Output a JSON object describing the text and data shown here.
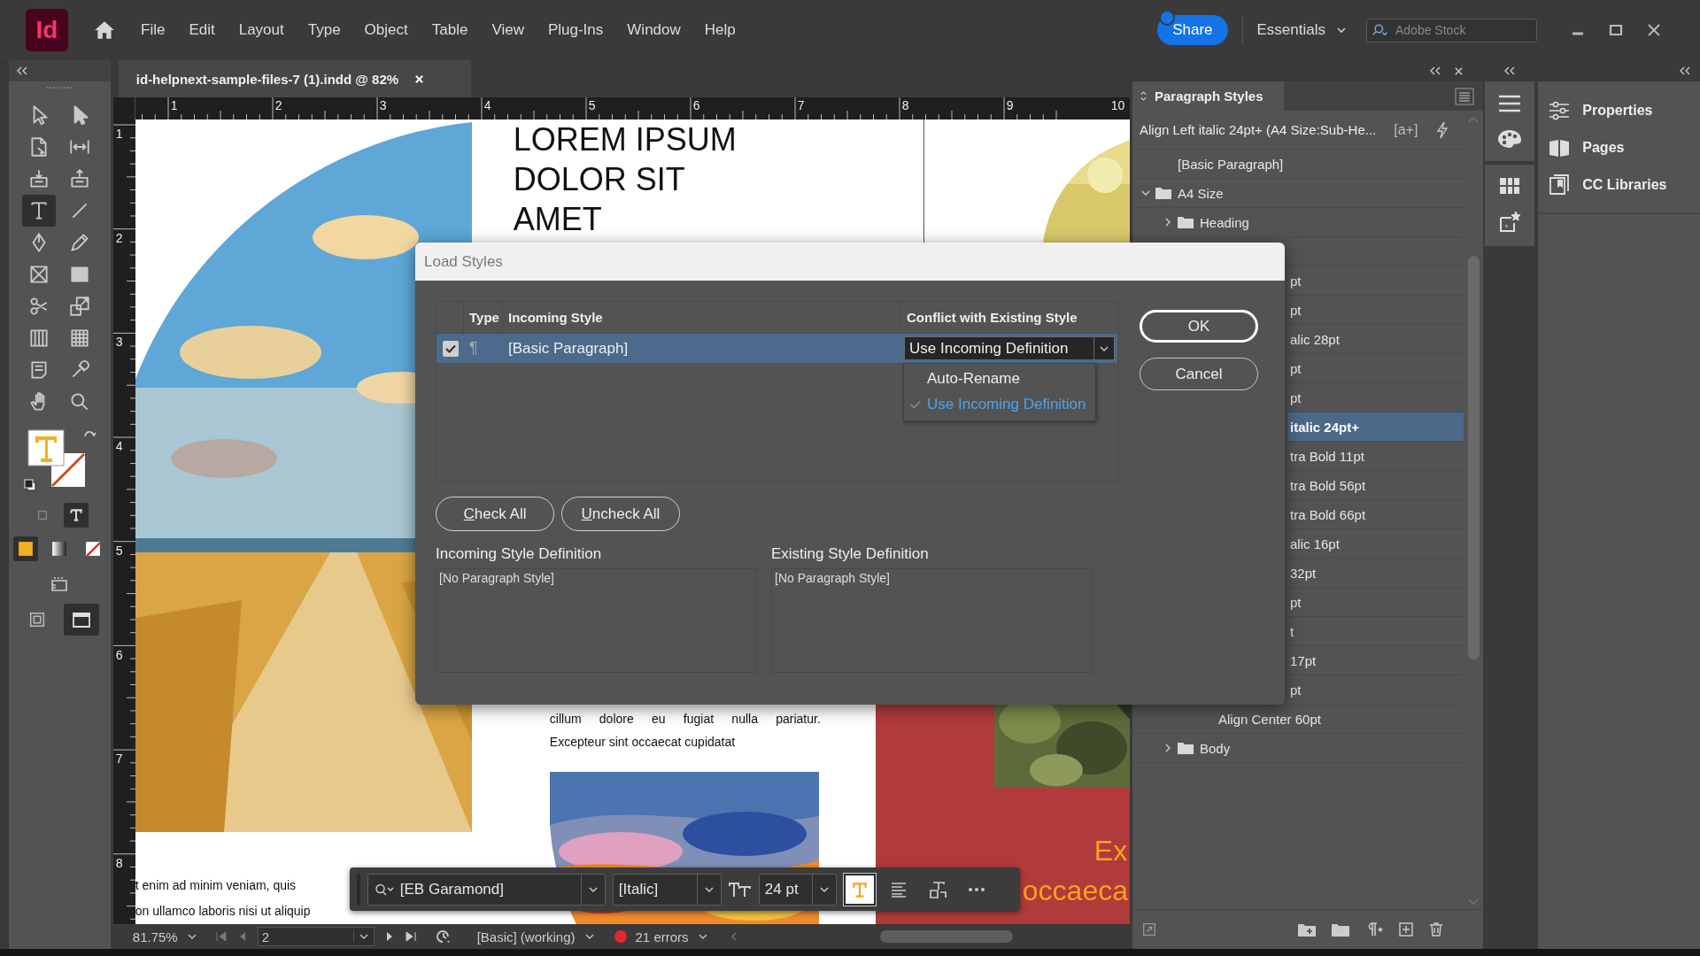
{
  "app": {
    "logo": "Id",
    "menus": [
      "File",
      "Edit",
      "Layout",
      "Type",
      "Object",
      "Table",
      "View",
      "Plug-Ins",
      "Window",
      "Help"
    ],
    "share": "Share",
    "workspace": "Essentials",
    "search": {
      "placeholder": "Adobe Stock"
    }
  },
  "document_tab": {
    "title": "id-helpnext-sample-files-7 (1).indd @ 82%"
  },
  "rulers": {
    "horizontal": [
      "1",
      "2",
      "3",
      "4",
      "5",
      "6",
      "7",
      "8",
      "9",
      "10"
    ],
    "vertical": [
      "1",
      "2",
      "3",
      "4",
      "5",
      "6",
      "7",
      "8"
    ]
  },
  "tools": [
    {
      "kind": "selection",
      "selected": false
    },
    {
      "kind": "direct",
      "selected": false
    },
    {
      "kind": "page",
      "selected": false
    },
    {
      "kind": "gap",
      "selected": false
    },
    {
      "kind": "collector",
      "selected": false
    },
    {
      "kind": "placer",
      "selected": false
    },
    {
      "kind": "type",
      "selected": true
    },
    {
      "kind": "line",
      "selected": false
    },
    {
      "kind": "pen",
      "selected": false
    },
    {
      "kind": "pencil",
      "selected": false
    },
    {
      "kind": "frame",
      "selected": false
    },
    {
      "kind": "rectangle",
      "selected": false
    },
    {
      "kind": "scissors",
      "selected": false
    },
    {
      "kind": "transform",
      "selected": false
    },
    {
      "kind": "gradient",
      "selected": false
    },
    {
      "kind": "feather",
      "selected": false
    },
    {
      "kind": "note",
      "selected": false
    },
    {
      "kind": "eyedropper",
      "selected": false
    },
    {
      "kind": "hand",
      "selected": false
    },
    {
      "kind": "zoom",
      "selected": false
    }
  ],
  "formatting": [
    {
      "kind": "container",
      "selected": false
    },
    {
      "kind": "text",
      "selected": true
    }
  ],
  "apply_modes": [
    {
      "kind": "color",
      "selected": true
    },
    {
      "kind": "gradient",
      "selected": false
    },
    {
      "kind": "none",
      "selected": false
    }
  ],
  "screen_modes": [
    {
      "kind": "preview",
      "selected": false
    },
    {
      "kind": "normal",
      "selected": true
    }
  ],
  "page": {
    "heading": [
      "LOREM IPSUM",
      "DOLOR SIT",
      "AMET"
    ],
    "body_lines": [
      "t enim ad minim veniam, quis",
      "on ullamco laboris nisi ut aliquip"
    ],
    "column_lines": [
      "cillum dolore eu fugiat nulla pariatur.",
      "Excepteur sint occaecat cupidatat"
    ],
    "callout": [
      "Ex",
      "occaeca"
    ]
  },
  "control_bar": {
    "font": "[EB Garamond]",
    "style": "[Italic]",
    "size": "24 pt",
    "buttons": [
      {
        "kind": "text-color",
        "selected": true
      },
      {
        "kind": "align",
        "selected": false
      },
      {
        "kind": "frame-fit",
        "selected": false
      },
      {
        "kind": "more",
        "selected": false
      }
    ]
  },
  "status_bar": {
    "zoom": "81.75%",
    "page": "2",
    "profile": "[Basic] (working)",
    "errors": "21 errors"
  },
  "paragraph_styles": {
    "title": "Paragraph Styles",
    "current": "Align Left italic 24pt+ (A4 Size:Sub-He...",
    "new_style": "[a+]",
    "items": [
      {
        "kind": "style",
        "name": "[Basic Paragraph]",
        "selected": false
      },
      {
        "kind": "folder",
        "name": "A4 Size",
        "expanded": true,
        "selected": false,
        "children": [
          {
            "kind": "folder",
            "name": "Heading",
            "expanded": false,
            "selected": false
          },
          {
            "kind": "covered",
            "children": [
              {
                "kind": "partial",
                "name": "pt",
                "selected": false
              },
              {
                "kind": "partial",
                "name": "pt",
                "selected": false
              },
              {
                "kind": "partial",
                "name": "alic 28pt",
                "selected": false
              },
              {
                "kind": "partial",
                "name": "pt",
                "selected": false
              },
              {
                "kind": "partial",
                "name": "pt",
                "selected": false
              },
              {
                "kind": "partial",
                "name": "italic 24pt+",
                "selected": true
              },
              {
                "kind": "partial",
                "name": "tra Bold 11pt",
                "selected": false
              },
              {
                "kind": "partial",
                "name": "tra Bold 56pt",
                "selected": false
              },
              {
                "kind": "partial",
                "name": "tra Bold 66pt",
                "selected": false
              },
              {
                "kind": "partial",
                "name": "alic 16pt",
                "selected": false
              },
              {
                "kind": "partial",
                "name": "32pt",
                "selected": false
              },
              {
                "kind": "partial",
                "name": "pt",
                "selected": false
              },
              {
                "kind": "partial",
                "name": "t",
                "selected": false
              },
              {
                "kind": "partial",
                "name": "17pt",
                "selected": false
              },
              {
                "kind": "partial",
                "name": "pt",
                "selected": false
              },
              {
                "kind": "style",
                "name": "Align Center 60pt",
                "selected": false
              }
            ]
          },
          {
            "kind": "folder",
            "name": "Body",
            "expanded": false,
            "selected": false
          }
        ]
      }
    ]
  },
  "side_panels": [
    {
      "kind": "properties",
      "label": "Properties"
    },
    {
      "kind": "pages",
      "label": "Pages"
    },
    {
      "kind": "libraries",
      "label": "CC Libraries"
    }
  ],
  "dialog": {
    "title": "Load Styles",
    "columns": [
      "Type",
      "Incoming Style",
      "Conflict with Existing Style"
    ],
    "rows": [
      {
        "checked": true,
        "type": "¶",
        "style": "[Basic Paragraph]",
        "conflict": "Use Incoming Definition",
        "open": true
      }
    ],
    "conflict_options": [
      {
        "label": "Auto-Rename",
        "selected": false
      },
      {
        "label": "Use Incoming Definition",
        "selected": true
      }
    ],
    "buttons": [
      {
        "label": "OK",
        "default": true
      },
      {
        "label": "Cancel",
        "default": false
      }
    ],
    "list_buttons": [
      {
        "label": "Check All",
        "underline_first": true
      },
      {
        "label": "Uncheck All",
        "underline_first": true
      }
    ],
    "definitions": [
      {
        "label": "Incoming Style Definition",
        "text": "[No Paragraph Style]"
      },
      {
        "label": "Existing Style Definition",
        "text": "[No Paragraph Style]"
      }
    ]
  }
}
